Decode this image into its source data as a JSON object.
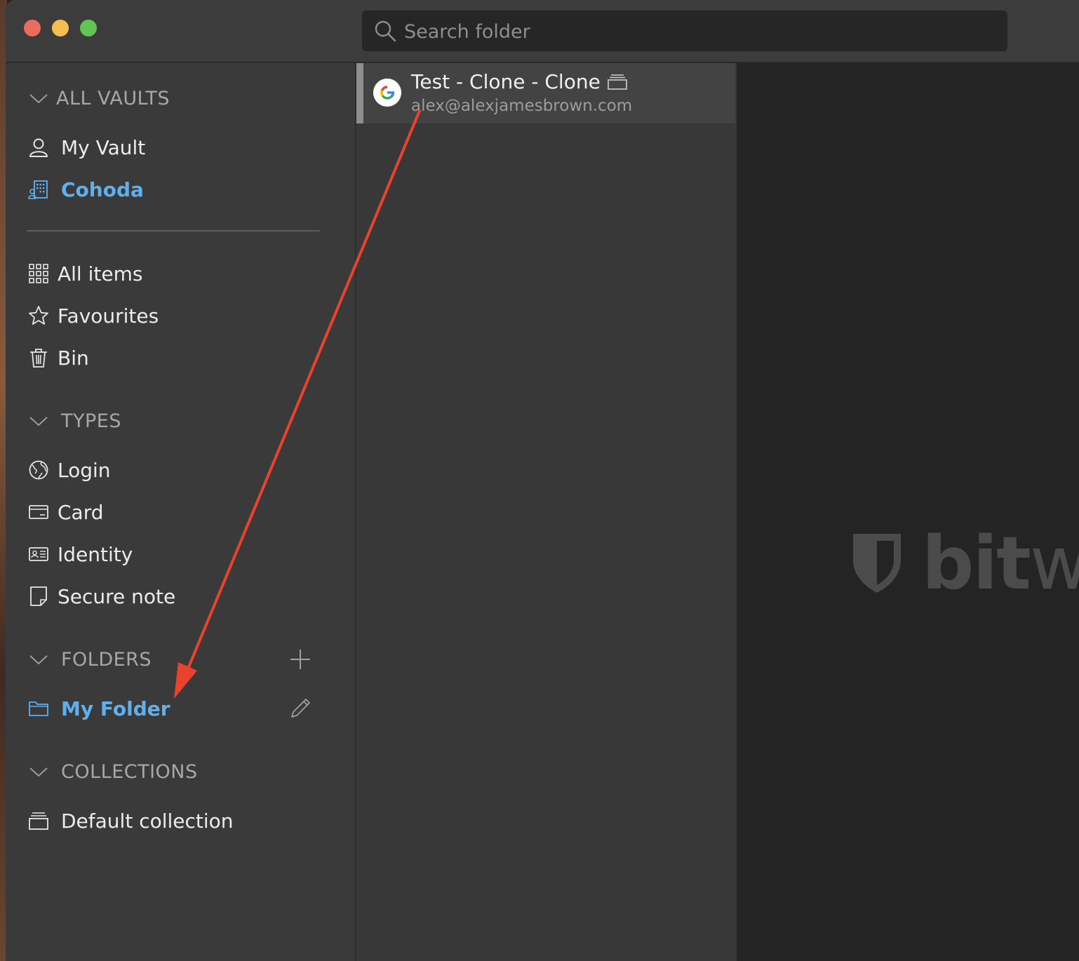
{
  "search": {
    "placeholder": "Search folder"
  },
  "sidebar": {
    "vaults_header": "ALL VAULTS",
    "vaults": [
      {
        "label": "My Vault",
        "icon": "user-icon"
      },
      {
        "label": "Cohoda",
        "icon": "building-icon"
      }
    ],
    "filters": [
      {
        "label": "All items",
        "icon": "grid-icon"
      },
      {
        "label": "Favourites",
        "icon": "star-icon"
      },
      {
        "label": "Bin",
        "icon": "trash-icon"
      }
    ],
    "types_header": "TYPES",
    "types": [
      {
        "label": "Login",
        "icon": "globe-icon"
      },
      {
        "label": "Card",
        "icon": "credit-card-icon"
      },
      {
        "label": "Identity",
        "icon": "id-card-icon"
      },
      {
        "label": "Secure note",
        "icon": "note-icon"
      }
    ],
    "folders_header": "FOLDERS",
    "folders": [
      {
        "label": "My Folder",
        "icon": "folder-icon"
      }
    ],
    "collections_header": "COLLECTIONS",
    "collections": [
      {
        "label": "Default collection",
        "icon": "collection-icon"
      }
    ]
  },
  "list": {
    "items": [
      {
        "title": "Test - Clone - Clone",
        "subtitle": "alex@alexjamesbrown.com",
        "icon": "google-icon"
      }
    ]
  },
  "detail": {
    "logo_bold": "bit",
    "logo_light": "wa"
  },
  "colors": {
    "accent": "#5fb0ef",
    "annotation": "#e8432d"
  }
}
